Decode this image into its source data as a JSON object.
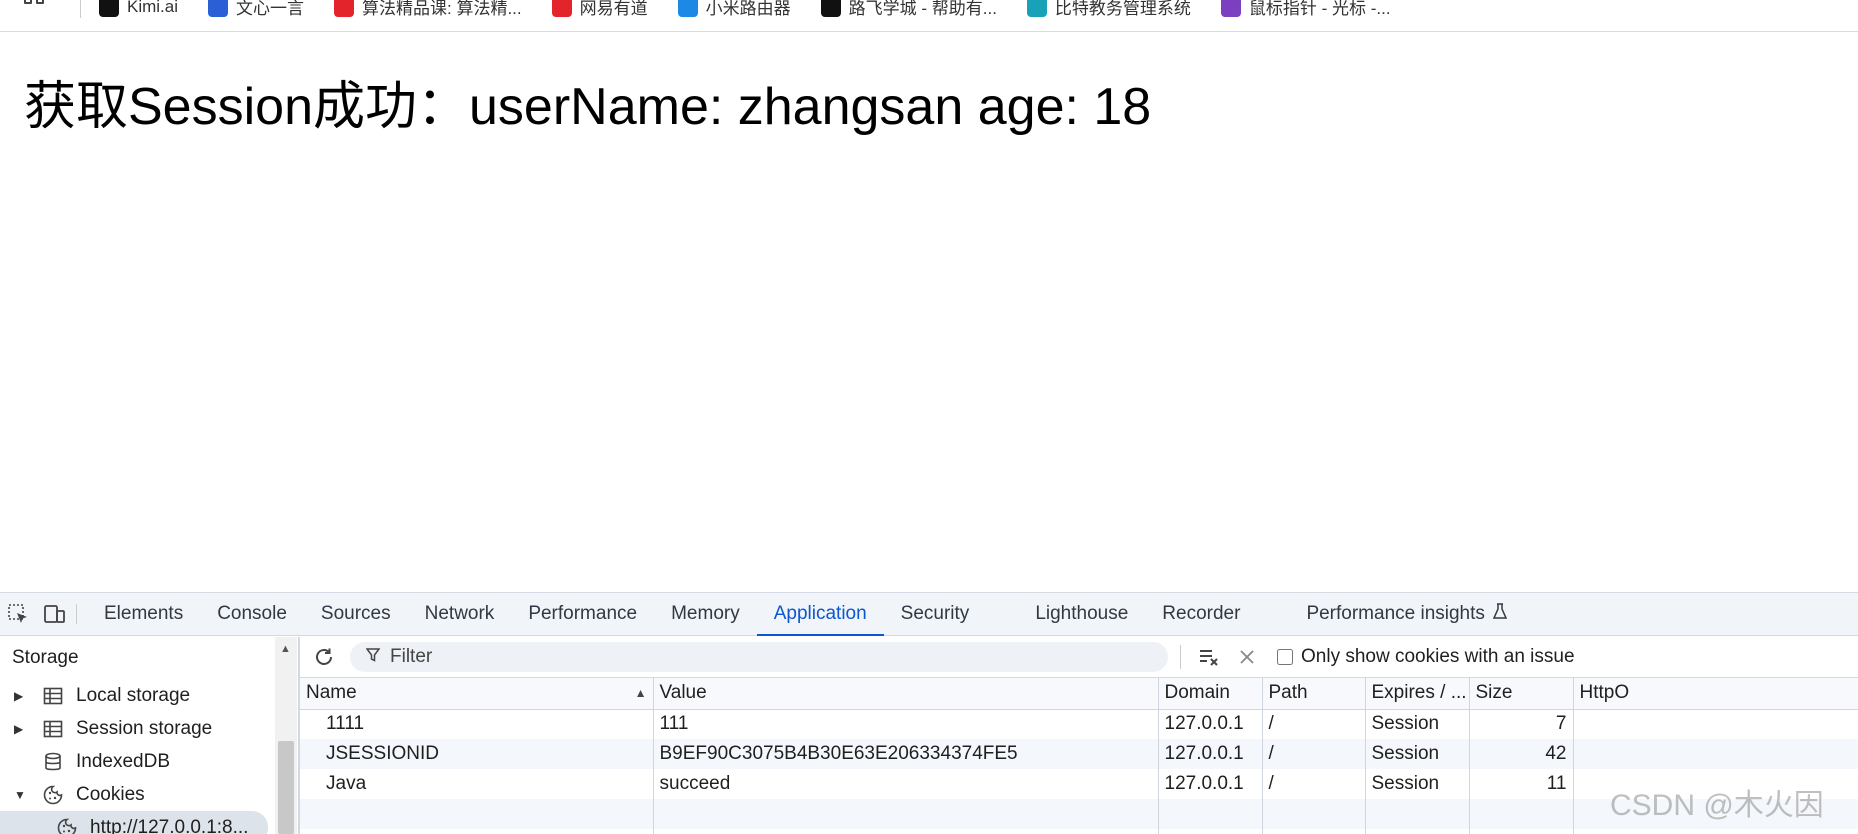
{
  "bookmarks": [
    {
      "label": "Kimi.ai",
      "icon": "kimi-icon",
      "color": "#111111"
    },
    {
      "label": "文心一言",
      "icon": "wenxin-icon",
      "color": "#2a5fd6"
    },
    {
      "label": "算法精品课: 算法精...",
      "icon": "algo-course-icon",
      "color": "#e3242b"
    },
    {
      "label": "网易有道",
      "icon": "youdao-icon",
      "color": "#e3242b"
    },
    {
      "label": "小米路由器",
      "icon": "wifi-icon",
      "color": "#1e88e5"
    },
    {
      "label": "路飞学城 - 帮助有...",
      "icon": "luffy-icon",
      "color": "#111111"
    },
    {
      "label": "比特教务管理系统",
      "icon": "bit-icon",
      "color": "#17a2b8"
    },
    {
      "label": "鼠标指针 - 光标 -...",
      "icon": "cursor-icon",
      "color": "#7b3fbf"
    }
  ],
  "page": {
    "heading": "获取Session成功：userName: zhangsan age: 18"
  },
  "devtools": {
    "tabs": [
      {
        "label": "Elements",
        "active": false
      },
      {
        "label": "Console",
        "active": false
      },
      {
        "label": "Sources",
        "active": false
      },
      {
        "label": "Network",
        "active": false
      },
      {
        "label": "Performance",
        "active": false
      },
      {
        "label": "Memory",
        "active": false
      },
      {
        "label": "Application",
        "active": true
      },
      {
        "label": "Security",
        "active": false
      },
      {
        "label": "Lighthouse",
        "active": false
      },
      {
        "label": "Recorder",
        "active": false
      },
      {
        "label": "Performance insights",
        "active": false
      }
    ],
    "sidebar": {
      "header": "Storage",
      "items": [
        {
          "label": "Local storage",
          "icon": "table-icon",
          "arrow": "▶"
        },
        {
          "label": "Session storage",
          "icon": "table-icon",
          "arrow": "▶"
        },
        {
          "label": "IndexedDB",
          "icon": "database-icon",
          "arrow": ""
        },
        {
          "label": "Cookies",
          "icon": "cookie-icon",
          "arrow": "▼"
        },
        {
          "label": "http://127.0.0.1:8...",
          "icon": "cookie-icon",
          "arrow": ""
        }
      ]
    },
    "toolbar": {
      "filter_placeholder": "Filter",
      "checkbox_label": "Only show cookies with an issue"
    },
    "table": {
      "columns": [
        "Name",
        "Value",
        "Domain",
        "Path",
        "Expires / ...",
        "Size",
        "HttpO"
      ],
      "rows": [
        [
          "1111",
          "111",
          "127.0.0.1",
          "/",
          "Session",
          "7",
          ""
        ],
        [
          "JSESSIONID",
          "B9EF90C3075B4B30E63E206334374FE5",
          "127.0.0.1",
          "/",
          "Session",
          "42",
          ""
        ],
        [
          "Java",
          "succeed",
          "127.0.0.1",
          "/",
          "Session",
          "11",
          ""
        ]
      ]
    }
  },
  "watermark": "CSDN @木火因",
  "colors": {
    "accent": "#0b57d0",
    "tabbar_bg": "#f1f4f9"
  }
}
